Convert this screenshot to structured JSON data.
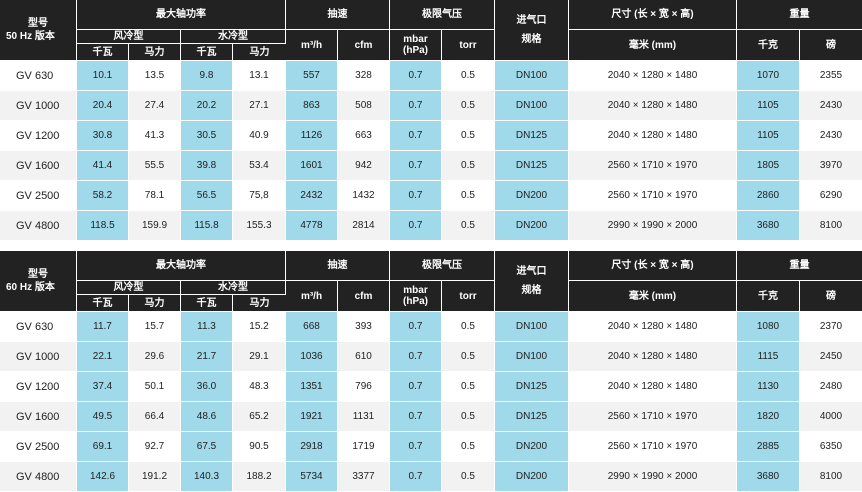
{
  "tables": [
    {
      "header": {
        "model": [
          "型号",
          "50 Hz 版本"
        ],
        "max_power": "最大轴功率",
        "air_cooled": "风冷型",
        "water_cooled": "水冷型",
        "kw": "千瓦",
        "hp": "马力",
        "pumping_speed": "抽速",
        "m3h": "m³/h",
        "cfm": "cfm",
        "ultimate_pressure": "极限气压",
        "mbar": "mbar",
        "hpa": "(hPa)",
        "torr": "torr",
        "inlet": [
          "进气口",
          "规格"
        ],
        "dimensions": "尺寸 (长 × 宽 × 高)",
        "mm": "毫米 (mm)",
        "weight": "重量",
        "kg": "千克",
        "lb": "磅"
      },
      "rows": [
        {
          "model": "GV 630",
          "air_kw": "10.1",
          "air_hp": "13.5",
          "water_kw": "9.8",
          "water_hp": "13.1",
          "m3h": "557",
          "cfm": "328",
          "mbar": "0.7",
          "torr": "0.5",
          "inlet": "DN100",
          "dim": "2040 × 1280 × 1480",
          "kg": "1070",
          "lb": "2355"
        },
        {
          "model": "GV 1000",
          "air_kw": "20.4",
          "air_hp": "27.4",
          "water_kw": "20.2",
          "water_hp": "27.1",
          "m3h": "863",
          "cfm": "508",
          "mbar": "0.7",
          "torr": "0.5",
          "inlet": "DN100",
          "dim": "2040 × 1280 × 1480",
          "kg": "1105",
          "lb": "2430"
        },
        {
          "model": "GV 1200",
          "air_kw": "30.8",
          "air_hp": "41.3",
          "water_kw": "30.5",
          "water_hp": "40.9",
          "m3h": "1126",
          "cfm": "663",
          "mbar": "0.7",
          "torr": "0.5",
          "inlet": "DN125",
          "dim": "2040 × 1280 × 1480",
          "kg": "1105",
          "lb": "2430"
        },
        {
          "model": "GV 1600",
          "air_kw": "41.4",
          "air_hp": "55.5",
          "water_kw": "39.8",
          "water_hp": "53.4",
          "m3h": "1601",
          "cfm": "942",
          "mbar": "0.7",
          "torr": "0.5",
          "inlet": "DN125",
          "dim": "2560 × 1710 × 1970",
          "kg": "1805",
          "lb": "3970"
        },
        {
          "model": "GV 2500",
          "air_kw": "58.2",
          "air_hp": "78.1",
          "water_kw": "56.5",
          "water_hp": "75,8",
          "m3h": "2432",
          "cfm": "1432",
          "mbar": "0.7",
          "torr": "0.5",
          "inlet": "DN200",
          "dim": "2560 × 1710 × 1970",
          "kg": "2860",
          "lb": "6290"
        },
        {
          "model": "GV 4800",
          "air_kw": "118.5",
          "air_hp": "159.9",
          "water_kw": "115.8",
          "water_hp": "155.3",
          "m3h": "4778",
          "cfm": "2814",
          "mbar": "0.7",
          "torr": "0.5",
          "inlet": "DN200",
          "dim": "2990 × 1990 × 2000",
          "kg": "3680",
          "lb": "8100"
        }
      ]
    },
    {
      "header": {
        "model": [
          "型号",
          "60 Hz 版本"
        ],
        "max_power": "最大轴功率",
        "air_cooled": "风冷型",
        "water_cooled": "水冷型",
        "kw": "千瓦",
        "hp": "马力",
        "pumping_speed": "抽速",
        "m3h": "m³/h",
        "cfm": "cfm",
        "ultimate_pressure": "极限气压",
        "mbar": "mbar",
        "hpa": "(hPa)",
        "torr": "torr",
        "inlet": [
          "进气口",
          "规格"
        ],
        "dimensions": "尺寸 (长 × 宽 × 高)",
        "mm": "毫米 (mm)",
        "weight": "重量",
        "kg": "千克",
        "lb": "磅"
      },
      "rows": [
        {
          "model": "GV 630",
          "air_kw": "11.7",
          "air_hp": "15.7",
          "water_kw": "11.3",
          "water_hp": "15.2",
          "m3h": "668",
          "cfm": "393",
          "mbar": "0.7",
          "torr": "0.5",
          "inlet": "DN100",
          "dim": "2040 × 1280 × 1480",
          "kg": "1080",
          "lb": "2370"
        },
        {
          "model": "GV 1000",
          "air_kw": "22.1",
          "air_hp": "29.6",
          "water_kw": "21.7",
          "water_hp": "29.1",
          "m3h": "1036",
          "cfm": "610",
          "mbar": "0.7",
          "torr": "0.5",
          "inlet": "DN100",
          "dim": "2040 × 1280 × 1480",
          "kg": "1115",
          "lb": "2450"
        },
        {
          "model": "GV 1200",
          "air_kw": "37.4",
          "air_hp": "50.1",
          "water_kw": "36.0",
          "water_hp": "48.3",
          "m3h": "1351",
          "cfm": "796",
          "mbar": "0.7",
          "torr": "0.5",
          "inlet": "DN125",
          "dim": "2040 × 1280 × 1480",
          "kg": "1130",
          "lb": "2480"
        },
        {
          "model": "GV 1600",
          "air_kw": "49.5",
          "air_hp": "66.4",
          "water_kw": "48.6",
          "water_hp": "65.2",
          "m3h": "1921",
          "cfm": "1131",
          "mbar": "0.7",
          "torr": "0.5",
          "inlet": "DN125",
          "dim": "2560 × 1710 × 1970",
          "kg": "1820",
          "lb": "4000"
        },
        {
          "model": "GV 2500",
          "air_kw": "69.1",
          "air_hp": "92.7",
          "water_kw": "67.5",
          "water_hp": "90.5",
          "m3h": "2918",
          "cfm": "1719",
          "mbar": "0.7",
          "torr": "0.5",
          "inlet": "DN200",
          "dim": "2560 × 1710 × 1970",
          "kg": "2885",
          "lb": "6350"
        },
        {
          "model": "GV 4800",
          "air_kw": "142.6",
          "air_hp": "191.2",
          "water_kw": "140.3",
          "water_hp": "188.2",
          "m3h": "5734",
          "cfm": "3377",
          "mbar": "0.7",
          "torr": "0.5",
          "inlet": "DN200",
          "dim": "2990 × 1990 × 2000",
          "kg": "3680",
          "lb": "8100"
        }
      ]
    }
  ],
  "colors": {
    "header_bg": "#222222",
    "highlight": "#9fd9ea",
    "row_alt": "#f2f2f2"
  }
}
